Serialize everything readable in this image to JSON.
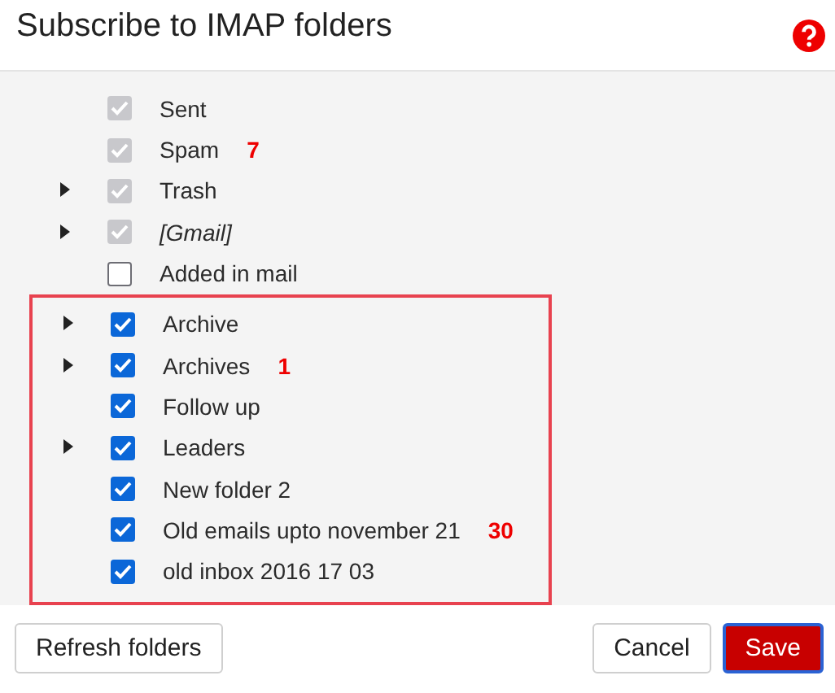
{
  "dialog": {
    "title": "Subscribe to IMAP folders"
  },
  "sections": [
    {
      "highlighted": false,
      "folders": [
        {
          "name": "Sent",
          "checked": true,
          "disabled": true,
          "expandable": false,
          "italic": false
        },
        {
          "name": "Spam",
          "count": "7",
          "checked": true,
          "disabled": true,
          "expandable": false,
          "italic": false
        },
        {
          "name": "Trash",
          "checked": true,
          "disabled": true,
          "expandable": true,
          "italic": false
        },
        {
          "name": "[Gmail]",
          "checked": true,
          "disabled": true,
          "expandable": true,
          "italic": true
        },
        {
          "name": "Added in mail",
          "checked": false,
          "disabled": false,
          "expandable": false,
          "italic": false
        }
      ]
    },
    {
      "highlighted": true,
      "folders": [
        {
          "name": "Archive",
          "checked": true,
          "disabled": false,
          "expandable": true,
          "italic": false
        },
        {
          "name": "Archives",
          "count": "1",
          "checked": true,
          "disabled": false,
          "expandable": true,
          "italic": false
        },
        {
          "name": "Follow up",
          "checked": true,
          "disabled": false,
          "expandable": false,
          "italic": false
        },
        {
          "name": "Leaders",
          "checked": true,
          "disabled": false,
          "expandable": true,
          "italic": false
        },
        {
          "name": "New folder 2",
          "checked": true,
          "disabled": false,
          "expandable": false,
          "italic": false
        },
        {
          "name": "Old emails upto november 21",
          "count": "30",
          "checked": true,
          "disabled": false,
          "expandable": false,
          "italic": false
        },
        {
          "name": "old inbox 2016 17 03",
          "checked": true,
          "disabled": false,
          "expandable": false,
          "italic": false
        }
      ]
    }
  ],
  "buttons": [
    {
      "label": "Refresh folders",
      "kind": "default"
    },
    {
      "label": "Cancel",
      "kind": "default"
    },
    {
      "label": "Save",
      "kind": "primary"
    }
  ]
}
